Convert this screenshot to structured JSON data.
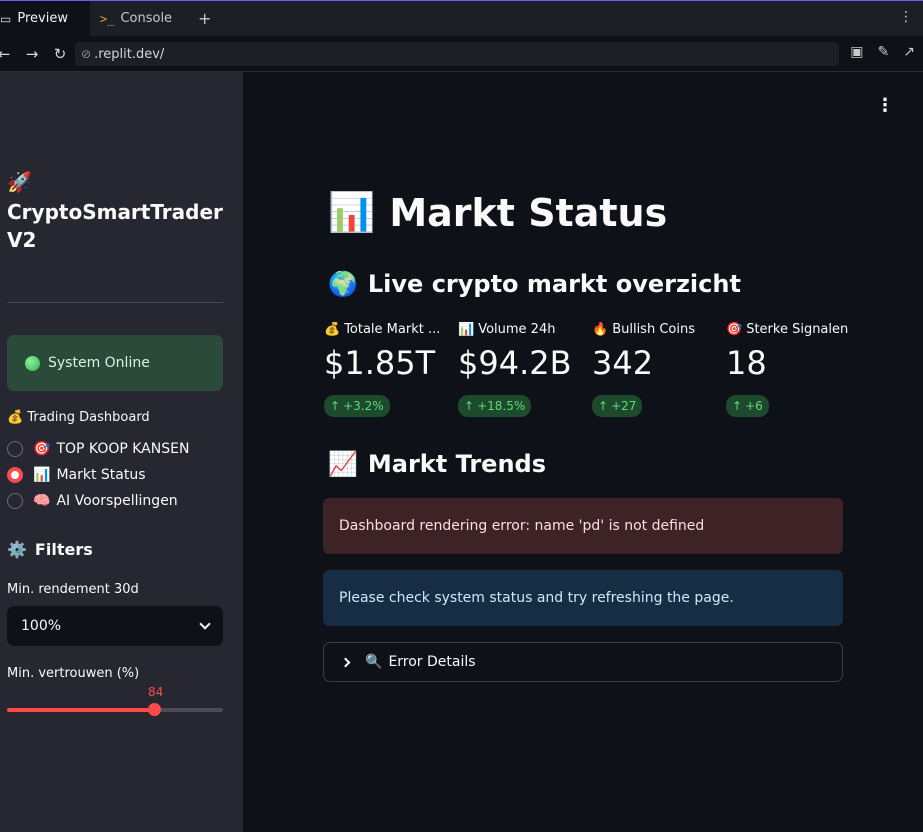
{
  "browser": {
    "tabs": [
      {
        "label": "Preview",
        "icon": "monitor-icon"
      },
      {
        "label": "Console",
        "icon": "terminal-icon"
      }
    ],
    "url": ".replit.dev/"
  },
  "sidebar": {
    "app_icon": "🚀",
    "app_title": "CryptoSmartTrader V2",
    "status_text": "System Online",
    "nav_label_icon": "💰",
    "nav_label": "Trading Dashboard",
    "nav_items": [
      {
        "icon": "🎯",
        "label": "TOP KOOP KANSEN",
        "selected": false
      },
      {
        "icon": "📊",
        "label": "Markt Status",
        "selected": true
      },
      {
        "icon": "🧠",
        "label": "AI Voorspellingen",
        "selected": false
      }
    ],
    "filters_icon": "⚙️",
    "filters_title": "Filters",
    "return_label": "Min. rendement 30d",
    "return_value": "100%",
    "confidence_label": "Min. vertrouwen (%)",
    "confidence_value": "84",
    "confidence_fraction": 0.68
  },
  "main": {
    "title_icon": "📊",
    "title": "Markt Status",
    "overview_icon": "🌍",
    "overview_title": "Live crypto markt overzicht",
    "metrics": [
      {
        "icon": "💰",
        "label": "Totale Markt ...",
        "value": "$1.85T",
        "delta": "+3.2%"
      },
      {
        "icon": "📊",
        "label": "Volume 24h",
        "value": "$94.2B",
        "delta": "+18.5%"
      },
      {
        "icon": "🔥",
        "label": "Bullish Coins",
        "value": "342",
        "delta": "+27"
      },
      {
        "icon": "🎯",
        "label": "Sterke Signalen",
        "value": "18",
        "delta": "+6"
      }
    ],
    "trends_icon": "📈",
    "trends_title": "Markt Trends",
    "error_message": "Dashboard rendering error: name 'pd' is not defined",
    "info_message": "Please check system status and try refreshing the page.",
    "expander_icon": "🔍",
    "expander_label": "Error Details"
  },
  "colors": {
    "accent": "#ff4b4b",
    "success": "#5fd97a",
    "sidebar_bg": "#262730",
    "main_bg": "#0e1117"
  }
}
